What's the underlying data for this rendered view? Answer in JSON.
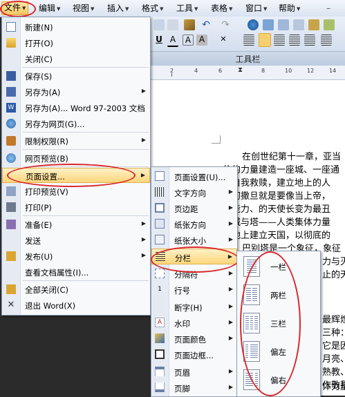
{
  "menubar": {
    "items": [
      "文件",
      "编辑",
      "视图",
      "插入",
      "格式",
      "工具",
      "表格",
      "窗口",
      "帮助"
    ]
  },
  "toolbar": {
    "label": "工具栏",
    "font_buttons": [
      "U",
      "A",
      "A",
      "A"
    ]
  },
  "ruler": {
    "numbers": [
      "2",
      "4",
      "6",
      "8",
      "10",
      "12",
      "14"
    ]
  },
  "file_menu": {
    "items": [
      {
        "label": "新建(N)",
        "icon": "new-doc-icon"
      },
      {
        "label": "打开(O)",
        "icon": "open-folder-icon"
      },
      {
        "label": "关闭(C)",
        "icon": ""
      },
      {
        "label": "保存(S)",
        "icon": "save-disk-icon"
      },
      {
        "label": "另存为(A)",
        "icon": "save-as-icon"
      },
      {
        "label": "另存为(A)... Word 97-2003 文档",
        "icon": "word-doc-icon"
      },
      {
        "label": "另存为网页(G)...",
        "icon": "web-save-icon"
      },
      {
        "label": "限制权限(R)",
        "icon": "lock-icon"
      },
      {
        "label": "网页预览(B)",
        "icon": "web-preview-icon"
      },
      {
        "label": "页面设置...",
        "icon": ""
      },
      {
        "label": "打印预览(V)",
        "icon": "print-preview-icon"
      },
      {
        "label": "打印(P)",
        "icon": "printer-icon"
      },
      {
        "label": "准备(E)",
        "icon": "prepare-icon"
      },
      {
        "label": "发送",
        "icon": ""
      },
      {
        "label": "发布(U)",
        "icon": "publish-icon"
      },
      {
        "label": "查看文档属性(I)...",
        "icon": ""
      },
      {
        "label": "全部关闭(C)",
        "icon": "close-all-icon"
      },
      {
        "label": "退出 Word(X)",
        "icon": "exit-x-icon"
      }
    ]
  },
  "page_setup_menu": {
    "items": [
      {
        "label": "页面设置(U)..."
      },
      {
        "label": "文字方向"
      },
      {
        "label": "页边距"
      },
      {
        "label": "纸张方向"
      },
      {
        "label": "纸张大小"
      },
      {
        "label": "分栏"
      },
      {
        "label": "分隔符"
      },
      {
        "label": "行号"
      },
      {
        "label": "断字(H)"
      },
      {
        "label": "水印"
      },
      {
        "label": "页面颜色"
      },
      {
        "label": "页面边框..."
      },
      {
        "label": "页眉"
      },
      {
        "label": "页脚"
      }
    ]
  },
  "columns_menu": {
    "items": [
      {
        "label": "一栏"
      },
      {
        "label": "两栏"
      },
      {
        "label": "三栏"
      },
      {
        "label": "偏左"
      },
      {
        "label": "偏右"
      }
    ]
  },
  "document": {
    "lines": [
      "在创世纪第十一章，亚当",
      "住的力量建造一座城、一座通",
      "首自我救赎，建立地上的人",
      "当初撒旦就是要像当上帝，",
      "有能力、的天使长变为最丑",
      "座城与塔——人类集体力量",
      "在地上建立天国，以彻底的",
      "巴别塔是一个象征，象征",
      "力与灭",
      "止的天",
      "最辉煌",
      "三种：",
      "它是因",
      "月亮、",
      "熟教、",
      "作敬拜",
      "体力量",
      "要止的"
    ]
  },
  "colors": {
    "highlight": "#fcd67c",
    "annotation_red": "#d9262b",
    "menubar_bg": "#dbe5f3"
  }
}
